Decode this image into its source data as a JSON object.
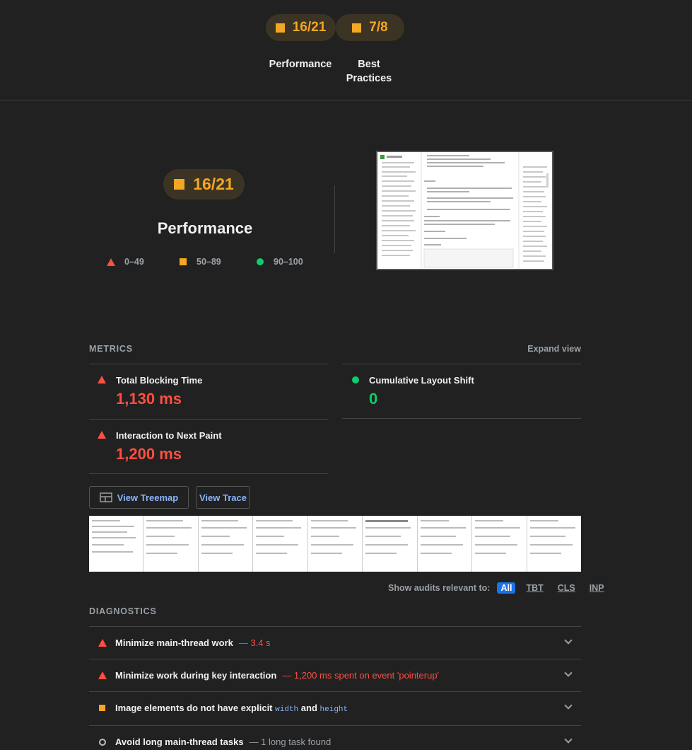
{
  "top_scores": [
    {
      "score": "16/21",
      "label": "Performance"
    },
    {
      "score": "7/8",
      "label": "Best Practices"
    }
  ],
  "performance": {
    "score": "16/21",
    "title": "Performance",
    "legend": [
      {
        "icon": "fail",
        "range": "0–49"
      },
      {
        "icon": "average",
        "range": "50–89"
      },
      {
        "icon": "pass",
        "range": "90–100"
      }
    ]
  },
  "metrics": {
    "title": "METRICS",
    "expand_label": "Expand view",
    "items": [
      {
        "label": "Total Blocking Time",
        "value": "1,130 ms",
        "status": "fail"
      },
      {
        "label": "Cumulative Layout Shift",
        "value": "0",
        "status": "pass"
      },
      {
        "label": "Interaction to Next Paint",
        "value": "1,200 ms",
        "status": "fail"
      }
    ]
  },
  "buttons": {
    "treemap": "View Treemap",
    "trace": "View Trace"
  },
  "filter": {
    "label": "Show audits relevant to:",
    "chips": [
      "All",
      "TBT",
      "CLS",
      "INP"
    ]
  },
  "diagnostics": {
    "title": "DIAGNOSTICS",
    "items": [
      {
        "title": "Minimize main-thread work",
        "display": "— 3.4 s",
        "status": "fail"
      },
      {
        "title": "Minimize work during key interaction",
        "display": "— 1,200 ms spent on event 'pointerup'",
        "status": "fail"
      },
      {
        "title_prefix": "Image elements do not have explicit",
        "code1": "width",
        "and": "and",
        "code2": "height",
        "status": "average"
      },
      {
        "title": "Avoid long main-thread tasks",
        "display": "— 1 long task found",
        "status": "informative"
      }
    ]
  },
  "colors": {
    "fail": "#ff4e42",
    "average": "#f5a623",
    "pass": "#0cce6b",
    "link": "#8ab4f8"
  }
}
